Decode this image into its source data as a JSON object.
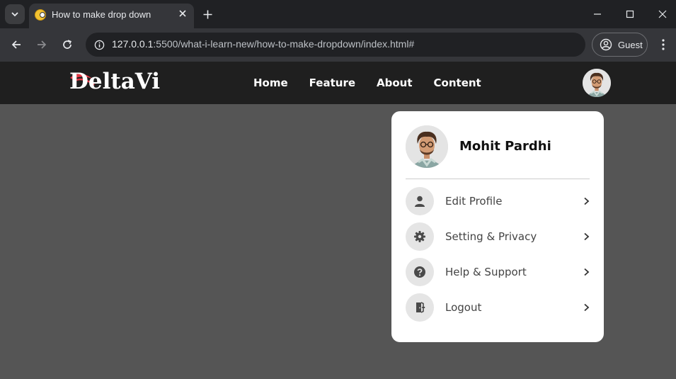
{
  "browser": {
    "tab_title": "How to make drop down",
    "url_host": "127.0.0.1",
    "url_rest": ":5500/what-i-learn-new/how-to-make-dropdown/index.html#",
    "profile_label": "Guest"
  },
  "site": {
    "logo": "DeltaVi",
    "nav": [
      "Home",
      "Feature",
      "About",
      "Content"
    ]
  },
  "dropdown": {
    "user_name": "Mohit Pardhi",
    "items": [
      {
        "label": "Edit Profile",
        "icon": "user-icon"
      },
      {
        "label": "Setting & Privacy",
        "icon": "gear-icon"
      },
      {
        "label": "Help & Support",
        "icon": "help-icon"
      },
      {
        "label": "Logout",
        "icon": "logout-icon"
      }
    ]
  },
  "colors": {
    "page_background": "#555555",
    "navbar": "#1f1f1f",
    "dropdown_background": "#ffffff",
    "icon_circle": "#e5e5e5",
    "logo_accent": "#e63946"
  }
}
